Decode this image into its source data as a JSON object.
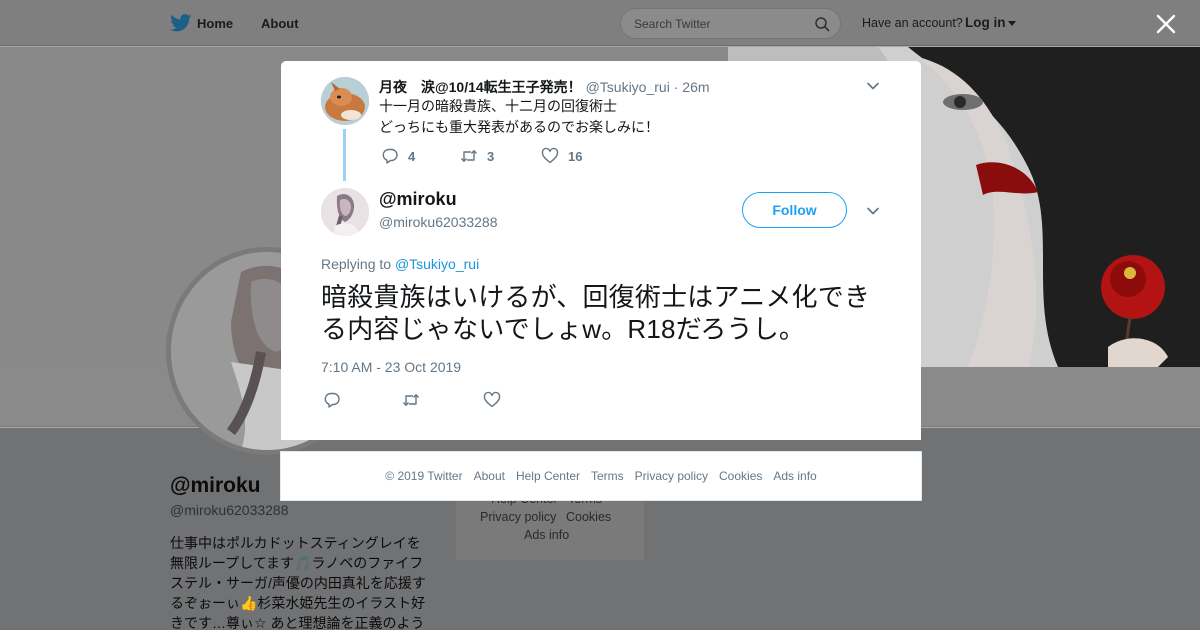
{
  "nav": {
    "home": "Home",
    "about": "About",
    "search_placeholder": "Search Twitter",
    "account_prompt": "Have an account?",
    "login": "Log in"
  },
  "profile": {
    "name": "@miroku",
    "handle": "@miroku62033288",
    "bio": "仕事中はポルカドットスティングレイを無限ループしてます🎵ラノベのファイフステル・サーガ/声優の内田真礼を応援するぞぉーぃ👍杉菜水姫先生のイラスト好きです…尊ぃ☆ あと理想論を正義のよう"
  },
  "background_footer": {
    "row1": [
      "Help Center",
      "Terms"
    ],
    "row2": [
      "Privacy policy",
      "Cookies"
    ],
    "row3": [
      "Ads info"
    ]
  },
  "original_tweet": {
    "name": "月夜　涙@10/14転生王子発売！",
    "handle": "@Tsukiyo_rui",
    "separator": "·",
    "time": "26m",
    "line1": "十一月の暗殺貴族、十二月の回復術士",
    "line2": "どっちにも重大発表があるのでお楽しみに！",
    "replies": "4",
    "retweets": "3",
    "likes": "16"
  },
  "main_tweet": {
    "name": "@miroku",
    "handle": "@miroku62033288",
    "follow": "Follow",
    "replying_prefix": "Replying to",
    "replying_to": "@Tsukiyo_rui",
    "text": "暗殺貴族はいけるが、回復術士はアニメ化できる内容じゃないでしょw。R18だろうし。",
    "timestamp": "7:10 AM - 23 Oct 2019"
  },
  "footer": {
    "copyright": "© 2019 Twitter",
    "about": "About",
    "help": "Help Center",
    "terms": "Terms",
    "privacy": "Privacy policy",
    "cookies": "Cookies",
    "ads": "Ads info"
  },
  "colors": {
    "accent": "#1da1f2",
    "link": "#1b95e0",
    "secondary_text": "#657786",
    "thread_line": "#9fd0f3"
  },
  "icons": {
    "logo": "twitter-bird-icon",
    "search": "search-icon",
    "close": "close-icon",
    "reply": "reply-icon",
    "retweet": "retweet-icon",
    "like": "heart-icon",
    "menu": "chevron-down-icon"
  }
}
